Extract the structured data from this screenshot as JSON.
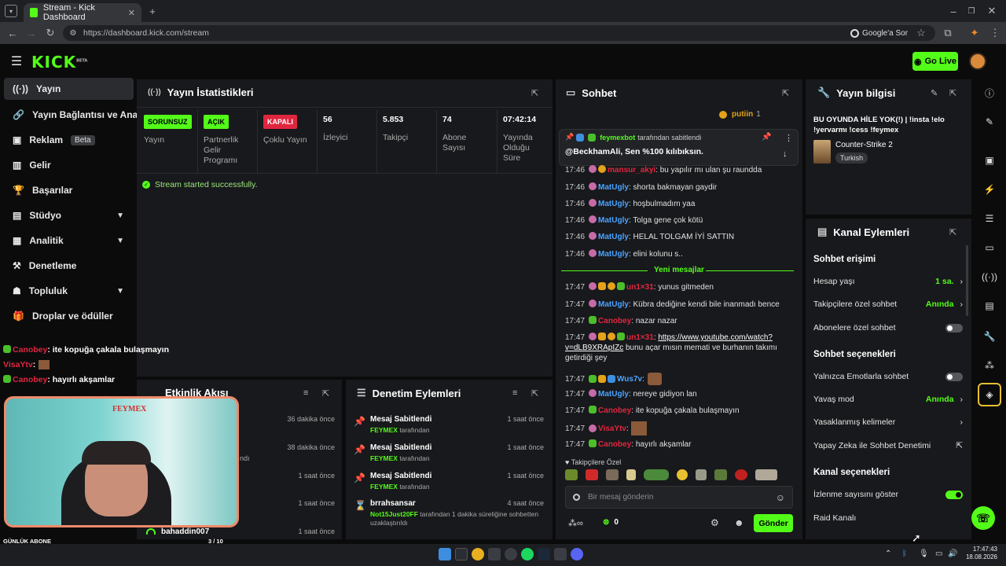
{
  "browser": {
    "tab_title": "Stream - Kick Dashboard",
    "url": "https://dashboard.kick.com/stream",
    "google_btn": "Google'a Sor"
  },
  "header": {
    "logo": "KICK",
    "logo_sup": "BETA",
    "go_live": "Go Live"
  },
  "sidebar": {
    "items": [
      {
        "label": "Yayın"
      },
      {
        "label": "Yayın Bağlantısı ve Anahtar"
      },
      {
        "label": "Reklam",
        "badge": "Beta"
      },
      {
        "label": "Gelir"
      },
      {
        "label": "Başarılar"
      },
      {
        "label": "Stüdyo"
      },
      {
        "label": "Analitik"
      },
      {
        "label": "Denetleme"
      },
      {
        "label": "Topluluk"
      },
      {
        "label": "Droplar ve ödüller"
      }
    ]
  },
  "overlay_chat": [
    {
      "user": "Canobey",
      "text": ": ite kopuğa çakala bulaşmayın"
    },
    {
      "user": "VisaYtv",
      "text": ":"
    },
    {
      "user": "Canobey",
      "text": ": hayırlı akşamlar"
    }
  ],
  "overlay": {
    "banner": "FEYMEX",
    "sub_label": "GÜNLÜK ABONE",
    "sub_count": "3 / 10",
    "sub_progress": 0.3
  },
  "stats": {
    "title": "Yayın İstatistikleri",
    "cols": [
      {
        "tag": "SORUNSUZ",
        "label": "Yayın"
      },
      {
        "tag": "AÇIK",
        "label": "Partnerlik Gelir Programı"
      },
      {
        "tag": "KAPALI",
        "label": "Çoklu Yayın"
      },
      {
        "value": "56",
        "label": "İzleyici"
      },
      {
        "value": "5.853",
        "label": "Takipçi"
      },
      {
        "value": "74",
        "label": "Abone Sayısı"
      },
      {
        "value": "07:42:14",
        "label": "Yayında Olduğu Süre"
      }
    ],
    "success": "Stream started successfully.",
    "colors": {
      "ok": "#53fc18",
      "off": "#e0263f"
    }
  },
  "activity": {
    "title": "Etkinlik Akışı",
    "rows": [
      {
        "name": "",
        "time": "36 dakika önce"
      },
      {
        "name": "",
        "time": "38 dakika önce",
        "sub": "ndı"
      },
      {
        "name": "",
        "time": "1 saat önce"
      },
      {
        "name": "",
        "time": "1 saat önce"
      },
      {
        "name": "bahaddin007",
        "time": "1 saat önce"
      }
    ]
  },
  "moderation": {
    "title": "Denetim Eylemleri",
    "rows": [
      {
        "action": "Mesaj Sabitlendi",
        "by": "FEYMEX",
        "suffix": " tarafından",
        "time": "1 saat önce"
      },
      {
        "action": "Mesaj Sabitlendi",
        "by": "FEYMEX",
        "suffix": " tarafından",
        "time": "1 saat önce"
      },
      {
        "action": "Mesaj Sabitlendi",
        "by": "FEYMEX",
        "suffix": " tarafından",
        "time": "1 saat önce"
      },
      {
        "action": "brrahsansar",
        "by": "Not15Just20FF",
        "suffix": " tarafından 1 dakika süreliğine sohbetten uzaklaştırıldı",
        "time": "4 saat önce"
      }
    ]
  },
  "chat": {
    "title": "Sohbet",
    "top_user": "putiin",
    "top_count": "1",
    "pinned_user": "feymexbot",
    "pinned_suffix": " tarafından sabitlendi",
    "pinned_text": "@BeckhamAli, Sen %100 kılıbıksın.",
    "messages_old": [
      {
        "time": "17:46",
        "user": "mansur_akyi",
        "text": ": bu yapılır mı ulan şu raundda",
        "color": "red"
      },
      {
        "time": "17:46",
        "user": "MatUgly",
        "text": ": shorta bakmayan gaydir",
        "color": "blue"
      },
      {
        "time": "17:46",
        "user": "MatUgly",
        "text": ": hoşbulmadım yaa",
        "color": "blue"
      },
      {
        "time": "17:46",
        "user": "MatUgly",
        "text": ": Tolga gene çok kötü",
        "color": "blue"
      },
      {
        "time": "17:46",
        "user": "MatUgly",
        "text": ": HELAL TOLGAM İYİ SATTIN",
        "color": "blue"
      },
      {
        "time": "17:46",
        "user": "MatUgly",
        "text": ": elini kolunu s..",
        "color": "blue"
      }
    ],
    "new_divider": "Yeni mesajlar",
    "messages_new": [
      {
        "time": "17:47",
        "user": "un1×31",
        "text": ": yunus gitmeden",
        "color": "red"
      },
      {
        "time": "17:47",
        "user": "MatUgly",
        "text": ": Kübra dediğine kendi bile inanmadı bence",
        "color": "blue"
      },
      {
        "time": "17:47",
        "user": "Canobey",
        "text": ": nazar nazar",
        "color": "red"
      },
      {
        "time": "17:47",
        "user": "un1×31",
        "text": ":",
        "link": "https://www.youtube.com/watch?",
        "link2": "v=dLB9XRApIZc",
        "rest": " bunu açar mısın memati ve burhanın takımı",
        "rest2": "getirdiği şey",
        "color": "red"
      },
      {
        "time": "17:47",
        "user": "Wus7v",
        "text": ":",
        "color": "blue"
      },
      {
        "time": "17:47",
        "user": "MatUgly",
        "text": ": nereye gidiyon lan",
        "color": "blue"
      },
      {
        "time": "17:47",
        "user": "Canobey",
        "text": ": ite kopuğa çakala bulaşmayın",
        "color": "red"
      },
      {
        "time": "17:47",
        "user": "VisaYtv",
        "text": ":",
        "color": "red"
      },
      {
        "time": "17:47",
        "user": "Canobey",
        "text": ": hayırlı akşamlar",
        "color": "red"
      }
    ],
    "followers_only": "Takipçilere Özel",
    "input_placeholder": "Bir mesaj gönderin",
    "points": "0",
    "send": "Gönder"
  },
  "stream_info": {
    "title": "Yayın bilgisi",
    "stream_title": "BU OYUNDA HİLE YOK(!) | !insta !elo !yervarmı !cess !feymex",
    "category": "Counter-Strike 2",
    "language": "Turkish"
  },
  "channel_actions": {
    "title": "Kanal Eylemleri",
    "chat_access": "Sohbet erişimi",
    "account_age": "Hesap yaşı",
    "account_age_val": "1 sa.",
    "followers_chat": "Takipçilere özel sohbet",
    "followers_chat_val": "Anında",
    "subs_chat": "Abonelere özel sohbet",
    "chat_options": "Sohbet seçenekleri",
    "emote_only": "Yalnızca Emotlarla sohbet",
    "slow_mode": "Yavaş mod",
    "slow_mode_val": "Anında",
    "banned_words": "Yasaklanmış kelimeler",
    "ai_mod": "Yapay Zeka ile Sohbet Denetimi",
    "channel_options": "Kanal seçenekleri",
    "show_viewers": "İzlenme sayısını göster",
    "raid": "Raid Kanalı"
  },
  "taskbar": {
    "time": "17:47:43",
    "date": "18.08.2026"
  }
}
